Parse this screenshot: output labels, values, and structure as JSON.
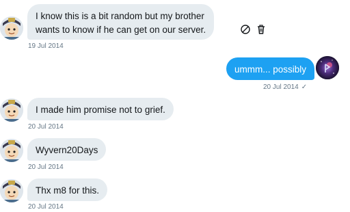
{
  "messages": [
    {
      "direction": "incoming",
      "lines": [
        "I know this is a bit random but my brother",
        "wants to know if he can get on our server."
      ],
      "timestamp": "19 Jul 2014"
    },
    {
      "direction": "outgoing",
      "lines": [
        "ummm... possibly"
      ],
      "timestamp": "20 Jul 2014",
      "status": "✓"
    },
    {
      "direction": "incoming",
      "lines": [
        "I made him promise not to grief."
      ],
      "timestamp": "20 Jul 2014"
    },
    {
      "direction": "incoming",
      "lines": [
        "Wyvern20Days"
      ],
      "timestamp": "20 Jul 2014"
    },
    {
      "direction": "incoming",
      "lines": [
        "Thx m8 for this."
      ],
      "timestamp": "20 Jul 2014"
    }
  ],
  "actions": {
    "hide_icon": "block-icon",
    "delete_icon": "trash-icon"
  },
  "colors": {
    "incoming_bubble": "#e6ecf0",
    "outgoing_bubble": "#1da1f2",
    "timestamp": "#657786"
  }
}
